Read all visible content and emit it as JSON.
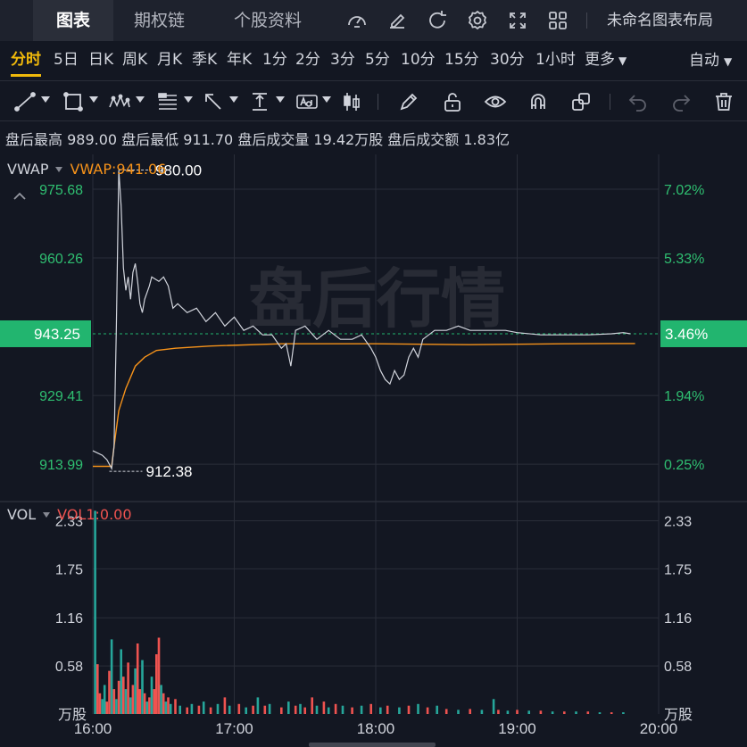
{
  "top_tabs": [
    {
      "label": "图表",
      "active": true
    },
    {
      "label": "期权链",
      "active": false
    },
    {
      "label": "个股资料",
      "active": false
    }
  ],
  "top_icons": [
    "gauge-icon",
    "edit-icon",
    "refresh-icon",
    "settings-icon",
    "fullscreen-icon",
    "grid-layout-icon"
  ],
  "layout_name": "未命名图表布局",
  "periods": [
    {
      "label": "分时",
      "active": true
    },
    {
      "label": "5日"
    },
    {
      "label": "日K"
    },
    {
      "label": "周K"
    },
    {
      "label": "月K"
    },
    {
      "label": "季K"
    },
    {
      "label": "年K"
    },
    {
      "label": "1分"
    },
    {
      "label": "2分"
    },
    {
      "label": "3分"
    },
    {
      "label": "5分"
    },
    {
      "label": "10分"
    },
    {
      "label": "15分"
    },
    {
      "label": "30分"
    },
    {
      "label": "1小时"
    },
    {
      "label": "更多"
    }
  ],
  "more_caret": "▼",
  "auto_label": "自动",
  "auto_caret": "▼",
  "drawing_tools": [
    "trendline-icon",
    "rectangle-icon",
    "pattern-icon",
    "fib-icon",
    "arrow-icon",
    "measure-icon",
    "text-icon",
    "candle-icon",
    "pencil-icon",
    "unlock-icon",
    "eye-icon",
    "magnet-icon",
    "copy-icon",
    "undo-icon",
    "redo-icon",
    "trash-icon"
  ],
  "stats": "盘后最高 989.00 盘后最低 911.70 盘后成交量 19.42万股 盘后成交额 1.83亿",
  "price_legend": {
    "name": "VWAP",
    "value": "VWAP:941.06"
  },
  "volume_legend": {
    "name": "VOL",
    "value": "VOL1:0.00"
  },
  "colors": {
    "up": "#26a69a",
    "down": "#ef5350",
    "price_line": "#d1d4dc",
    "vwap": "#f7931a",
    "current_badge": "#22b56f",
    "axis_text": "#2fbf71"
  },
  "chart_data": [
    {
      "type": "line",
      "title": "",
      "watermark": "盘后行情",
      "x_ticks": [
        "16:00",
        "17:00",
        "18:00",
        "19:00",
        "20:00"
      ],
      "x_range": [
        0,
        240
      ],
      "ylim": [
        906.0,
        983.5
      ],
      "y_ticks_left": [
        "975.68",
        "960.26",
        "929.41",
        "913.99"
      ],
      "y_ticks_right": [
        "7.02%",
        "5.33%",
        "1.94%",
        "0.25%"
      ],
      "y_tick_values": [
        975.68,
        960.26,
        929.41,
        913.99
      ],
      "current_price": "943.25",
      "current_pct": "3.46%",
      "current_value": 943.25,
      "max_label": "980.00",
      "max_point": [
        11,
        980.0
      ],
      "min_label": "912.38",
      "min_point": [
        7,
        912.38
      ],
      "series": [
        {
          "name": "VWAP",
          "points": [
            [
              0,
              913.5
            ],
            [
              8,
              913.5
            ],
            [
              9,
              918
            ],
            [
              11,
              926
            ],
            [
              14,
              931
            ],
            [
              18,
              936
            ],
            [
              22,
              938
            ],
            [
              27,
              939.5
            ],
            [
              35,
              940
            ],
            [
              50,
              940.5
            ],
            [
              80,
              941
            ],
            [
              120,
              941
            ],
            [
              160,
              940.8
            ],
            [
              200,
              941
            ],
            [
              220,
              941.06
            ],
            [
              230,
              941.06
            ]
          ]
        },
        {
          "points": [
            [
              0,
              917
            ],
            [
              4,
              916
            ],
            [
              6,
              915
            ],
            [
              8,
              913
            ],
            [
              9,
              918
            ],
            [
              10,
              945
            ],
            [
              11,
              980
            ],
            [
              12,
              972
            ],
            [
              13,
              958
            ],
            [
              14,
              953
            ],
            [
              15,
              956
            ],
            [
              16,
              951
            ],
            [
              17,
              957
            ],
            [
              18,
              959
            ],
            [
              19,
              955
            ],
            [
              20,
              950
            ],
            [
              21,
              948
            ],
            [
              22,
              951
            ],
            [
              24,
              954
            ],
            [
              25,
              956
            ],
            [
              28,
              955
            ],
            [
              30,
              956
            ],
            [
              32,
              954
            ],
            [
              34,
              949
            ],
            [
              36,
              950
            ],
            [
              40,
              948
            ],
            [
              44,
              949
            ],
            [
              48,
              946
            ],
            [
              52,
              948
            ],
            [
              56,
              945
            ],
            [
              60,
              947
            ],
            [
              64,
              944
            ],
            [
              68,
              945
            ],
            [
              72,
              943
            ],
            [
              76,
              943
            ],
            [
              80,
              940
            ],
            [
              82,
              941
            ],
            [
              84,
              936
            ],
            [
              86,
              944
            ],
            [
              90,
              945
            ],
            [
              95,
              942
            ],
            [
              100,
              944
            ],
            [
              105,
              942
            ],
            [
              110,
              942
            ],
            [
              114,
              943
            ],
            [
              118,
              940
            ],
            [
              120,
              938
            ],
            [
              122,
              935
            ],
            [
              124,
              933
            ],
            [
              126,
              932
            ],
            [
              128,
              935
            ],
            [
              130,
              933
            ],
            [
              132,
              934
            ],
            [
              134,
              938
            ],
            [
              136,
              940
            ],
            [
              138,
              938
            ],
            [
              140,
              942
            ],
            [
              145,
              944
            ],
            [
              150,
              944
            ],
            [
              155,
              945
            ],
            [
              160,
              944
            ],
            [
              165,
              944
            ],
            [
              170,
              944
            ],
            [
              175,
              944
            ],
            [
              180,
              943.5
            ],
            [
              190,
              943
            ],
            [
              200,
              943
            ],
            [
              210,
              943
            ],
            [
              220,
              943.25
            ],
            [
              225,
              943.5
            ],
            [
              228,
              943.25
            ]
          ]
        }
      ]
    },
    {
      "type": "bar",
      "title": "",
      "unit": "万股",
      "ylim": [
        0,
        2.55
      ],
      "y_ticks": [
        "2.33",
        "1.75",
        "1.16",
        "0.58"
      ],
      "y_tick_values": [
        2.33,
        1.75,
        1.16,
        0.58
      ],
      "bars": [
        [
          1,
          2.45,
          "up"
        ],
        [
          2,
          0.6,
          "down"
        ],
        [
          3,
          0.25,
          "down"
        ],
        [
          4,
          0.18,
          "up"
        ],
        [
          5,
          0.35,
          "up"
        ],
        [
          6,
          0.15,
          "down"
        ],
        [
          7,
          0.52,
          "down"
        ],
        [
          8,
          0.9,
          "up"
        ],
        [
          9,
          0.3,
          "down"
        ],
        [
          10,
          0.18,
          "up"
        ],
        [
          11,
          0.4,
          "down"
        ],
        [
          12,
          0.78,
          "up"
        ],
        [
          13,
          0.45,
          "down"
        ],
        [
          14,
          0.3,
          "up"
        ],
        [
          15,
          0.62,
          "down"
        ],
        [
          16,
          0.2,
          "up"
        ],
        [
          17,
          0.35,
          "down"
        ],
        [
          18,
          0.55,
          "up"
        ],
        [
          19,
          0.85,
          "down"
        ],
        [
          20,
          0.3,
          "down"
        ],
        [
          21,
          0.65,
          "up"
        ],
        [
          22,
          0.25,
          "down"
        ],
        [
          23,
          0.15,
          "up"
        ],
        [
          24,
          0.2,
          "down"
        ],
        [
          25,
          0.45,
          "up"
        ],
        [
          26,
          0.3,
          "down"
        ],
        [
          27,
          0.72,
          "down"
        ],
        [
          28,
          0.92,
          "down"
        ],
        [
          29,
          0.35,
          "up"
        ],
        [
          30,
          0.25,
          "down"
        ],
        [
          31,
          0.15,
          "up"
        ],
        [
          32,
          0.2,
          "down"
        ],
        [
          33,
          0.12,
          "up"
        ],
        [
          35,
          0.18,
          "down"
        ],
        [
          37,
          0.1,
          "up"
        ],
        [
          40,
          0.08,
          "down"
        ],
        [
          42,
          0.12,
          "up"
        ],
        [
          45,
          0.1,
          "down"
        ],
        [
          47,
          0.15,
          "up"
        ],
        [
          50,
          0.08,
          "down"
        ],
        [
          53,
          0.12,
          "up"
        ],
        [
          56,
          0.2,
          "down"
        ],
        [
          58,
          0.1,
          "up"
        ],
        [
          62,
          0.12,
          "down"
        ],
        [
          65,
          0.08,
          "up"
        ],
        [
          68,
          0.1,
          "down"
        ],
        [
          70,
          0.2,
          "up"
        ],
        [
          73,
          0.1,
          "down"
        ],
        [
          75,
          0.12,
          "up"
        ],
        [
          80,
          0.08,
          "down"
        ],
        [
          83,
          0.15,
          "up"
        ],
        [
          86,
          0.1,
          "down"
        ],
        [
          88,
          0.12,
          "up"
        ],
        [
          90,
          0.08,
          "down"
        ],
        [
          93,
          0.2,
          "down"
        ],
        [
          95,
          0.1,
          "up"
        ],
        [
          98,
          0.15,
          "down"
        ],
        [
          100,
          0.08,
          "up"
        ],
        [
          103,
          0.12,
          "down"
        ],
        [
          106,
          0.1,
          "up"
        ],
        [
          110,
          0.08,
          "down"
        ],
        [
          114,
          0.1,
          "up"
        ],
        [
          118,
          0.12,
          "down"
        ],
        [
          122,
          0.08,
          "up"
        ],
        [
          125,
          0.1,
          "down"
        ],
        [
          130,
          0.08,
          "up"
        ],
        [
          134,
          0.1,
          "down"
        ],
        [
          138,
          0.12,
          "up"
        ],
        [
          142,
          0.08,
          "down"
        ],
        [
          146,
          0.1,
          "up"
        ],
        [
          150,
          0.06,
          "down"
        ],
        [
          155,
          0.05,
          "up"
        ],
        [
          160,
          0.06,
          "down"
        ],
        [
          165,
          0.05,
          "up"
        ],
        [
          170,
          0.18,
          "up"
        ],
        [
          172,
          0.05,
          "down"
        ],
        [
          176,
          0.04,
          "up"
        ],
        [
          180,
          0.05,
          "down"
        ],
        [
          185,
          0.04,
          "up"
        ],
        [
          190,
          0.04,
          "down"
        ],
        [
          195,
          0.03,
          "up"
        ],
        [
          200,
          0.03,
          "down"
        ],
        [
          205,
          0.03,
          "up"
        ],
        [
          210,
          0.03,
          "down"
        ],
        [
          215,
          0.02,
          "up"
        ],
        [
          220,
          0.02,
          "down"
        ],
        [
          225,
          0.02,
          "up"
        ]
      ]
    }
  ]
}
